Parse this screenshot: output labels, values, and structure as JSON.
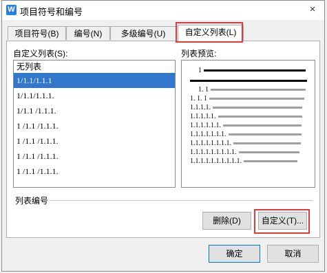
{
  "window": {
    "title": "项目符号和编号",
    "close": "×",
    "app_icon_letter": "W"
  },
  "tabs": [
    {
      "label": "项目符号(B)"
    },
    {
      "label": "编号(N)"
    },
    {
      "label": "多级编号(U)"
    },
    {
      "label": "自定义列表(L)",
      "active": true
    }
  ],
  "custom_list": {
    "label": "自定义列表(S):",
    "items": [
      "无列表",
      "1/1.1/1.1.1",
      "1/1.1/1.1.1.",
      "1/1.1 /1.1.1.",
      "1 /1.1 /1.1.1.",
      "1 /1.1 /1.1.1.",
      "1 /1.1 /1.1.1.",
      "1 /1.1 /1.1.1."
    ],
    "selected_index": 1
  },
  "preview": {
    "label": "列表预览:",
    "levels": [
      "1",
      "1. 1",
      "1. 1. 1",
      "1.1.1.1.",
      "1.1.1.1.1.",
      "1.1.1.1.1.1.",
      "1.1.1.1.1.1.1.",
      "1.1.1.1.1.1.1.1.",
      "1.1.1.1.1.1.1.1.1.",
      "1.1.1.1.1.1.1.1.1.1."
    ]
  },
  "list_numbering": {
    "label": "列表编号"
  },
  "buttons": {
    "delete": "删除(D)",
    "customize": "自定义(T)...",
    "ok": "确定",
    "cancel": "取消"
  },
  "colors": {
    "highlight": "#e53935",
    "selection": "#3377cc",
    "accent": "#0078d7"
  }
}
